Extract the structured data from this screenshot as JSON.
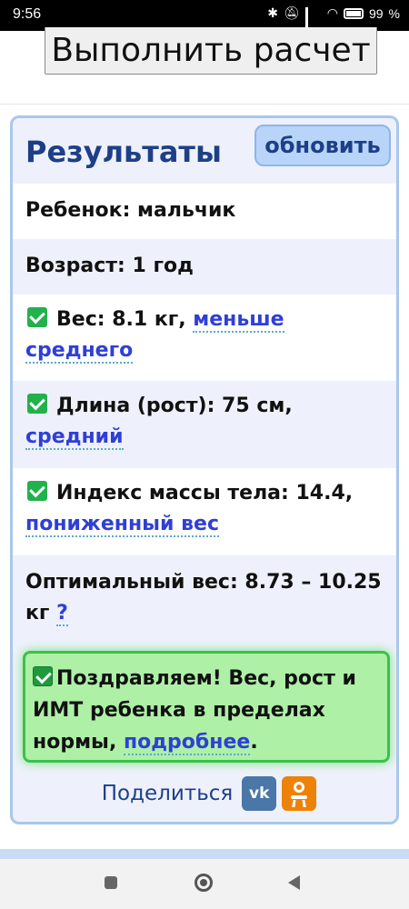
{
  "status_bar": {
    "time": "9:56",
    "battery": "99"
  },
  "calc_button": "Выполнить расчет",
  "results": {
    "title": "Результаты",
    "refresh": "обновить",
    "child": "Ребенок: мальчик",
    "age": "Возраст: 1 год",
    "weight_prefix": "Вес: 8.1 кг,",
    "weight_link": "меньше среднего",
    "height_prefix": "Длина (рост): 75 см,",
    "height_link": "средний",
    "bmi_prefix": "Индекс массы тела: 14.4,",
    "bmi_link": "пониженный вес",
    "optimal_prefix": "Оптимальный вес: 8.73 – 10.25 кг",
    "optimal_link": "?",
    "congrats_text": "Поздравляем! Вес, рост и ИМТ ребенка в пределах нормы,",
    "congrats_link": "подробнее",
    "congrats_end": ".",
    "share_label": "Поделиться",
    "vk_label": "vk"
  },
  "colors": {
    "title": "#1d3f87",
    "link": "#2f3fd6",
    "check": "#22b14c",
    "congrats_bg": "#aef0a6",
    "card_border": "#a9c7ee"
  },
  "icons": [
    "bluetooth-icon",
    "mute-icon",
    "signal-icon",
    "wifi-icon",
    "battery-icon",
    "checkmark-icon",
    "vk-icon",
    "odnoklassniki-icon",
    "recent-apps-icon",
    "home-icon",
    "back-icon"
  ]
}
